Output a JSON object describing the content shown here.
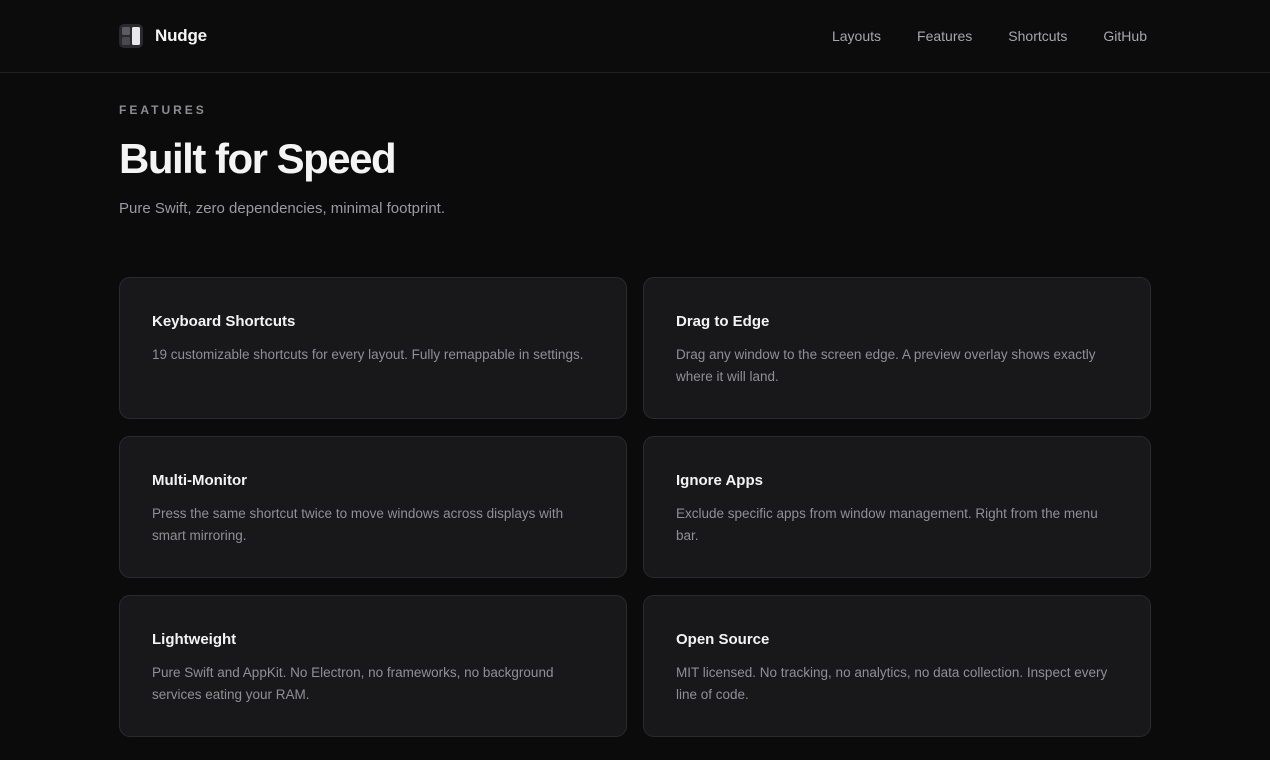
{
  "header": {
    "brand_name": "Nudge",
    "nav": [
      "Layouts",
      "Features",
      "Shortcuts",
      "GitHub"
    ]
  },
  "hero": {
    "eyebrow": "FEATURES",
    "title": "Built for Speed",
    "subtitle": "Pure Swift, zero dependencies, minimal footprint."
  },
  "features": [
    {
      "title": "Keyboard Shortcuts",
      "description": "19 customizable shortcuts for every layout. Fully remappable in settings."
    },
    {
      "title": "Drag to Edge",
      "description": "Drag any window to the screen edge. A preview overlay shows exactly where it will land."
    },
    {
      "title": "Multi-Monitor",
      "description": "Press the same shortcut twice to move windows across displays with smart mirroring."
    },
    {
      "title": "Ignore Apps",
      "description": "Exclude specific apps from window management. Right from the menu bar."
    },
    {
      "title": "Lightweight",
      "description": "Pure Swift and AppKit. No Electron, no frameworks, no background services eating your RAM."
    },
    {
      "title": "Open Source",
      "description": "MIT licensed. No tracking, no analytics, no data collection. Inspect every line of code."
    }
  ],
  "colors": {
    "background": "#0b0b0c",
    "card": "#18181b",
    "card_border": "#2a2a2f",
    "text_primary": "#f3f3f4",
    "text_muted": "#8f8f95"
  },
  "icons": {
    "logo": "window-grid-logo-icon"
  }
}
